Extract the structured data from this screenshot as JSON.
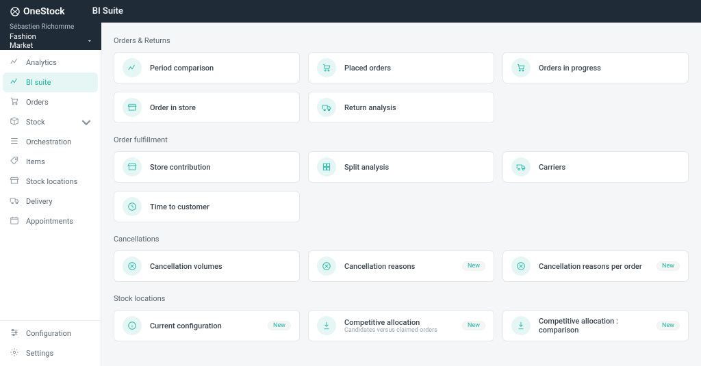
{
  "brand": "OneStock",
  "page_title": "BI Suite",
  "user": "Sébastien Richomme",
  "tenant": "Fashion Market",
  "nav": [
    {
      "label": "Analytics",
      "icon": "chart"
    },
    {
      "label": "BI suite",
      "icon": "chart",
      "active": true
    },
    {
      "label": "Orders",
      "icon": "cart"
    },
    {
      "label": "Stock",
      "icon": "box",
      "expandable": true
    },
    {
      "label": "Orchestration",
      "icon": "list"
    },
    {
      "label": "Items",
      "icon": "tag"
    },
    {
      "label": "Stock locations",
      "icon": "store"
    },
    {
      "label": "Delivery",
      "icon": "truck"
    },
    {
      "label": "Appointments",
      "icon": "calendar"
    }
  ],
  "nav_bottom": [
    {
      "label": "Configuration",
      "icon": "sliders"
    },
    {
      "label": "Settings",
      "icon": "gear"
    }
  ],
  "sections": [
    {
      "title": "Orders & Returns",
      "cards": [
        {
          "label": "Period comparison",
          "icon": "chart"
        },
        {
          "label": "Placed orders",
          "icon": "cart"
        },
        {
          "label": "Orders in progress",
          "icon": "cart"
        },
        {
          "label": "Order in store",
          "icon": "store"
        },
        {
          "label": "Return analysis",
          "icon": "truck"
        }
      ]
    },
    {
      "title": "Order fulfillment",
      "cards": [
        {
          "label": "Store contribution",
          "icon": "store"
        },
        {
          "label": "Split analysis",
          "icon": "split"
        },
        {
          "label": "Carriers",
          "icon": "truck"
        },
        {
          "label": "Time to customer",
          "icon": "clock"
        }
      ]
    },
    {
      "title": "Cancellations",
      "cards": [
        {
          "label": "Cancellation volumes",
          "icon": "cancel"
        },
        {
          "label": "Cancellation reasons",
          "icon": "cancel",
          "badge": "New"
        },
        {
          "label": "Cancellation reasons per order",
          "icon": "cancel",
          "badge": "New"
        }
      ]
    },
    {
      "title": "Stock locations",
      "cards": [
        {
          "label": "Current configuration",
          "icon": "info",
          "badge": "New"
        },
        {
          "label": "Competitive allocation",
          "sub": "Candidates versus claimed orders",
          "icon": "pointer",
          "badge": "New"
        },
        {
          "label": "Competitive allocation : comparison",
          "icon": "pointer",
          "badge": "New"
        }
      ]
    }
  ]
}
